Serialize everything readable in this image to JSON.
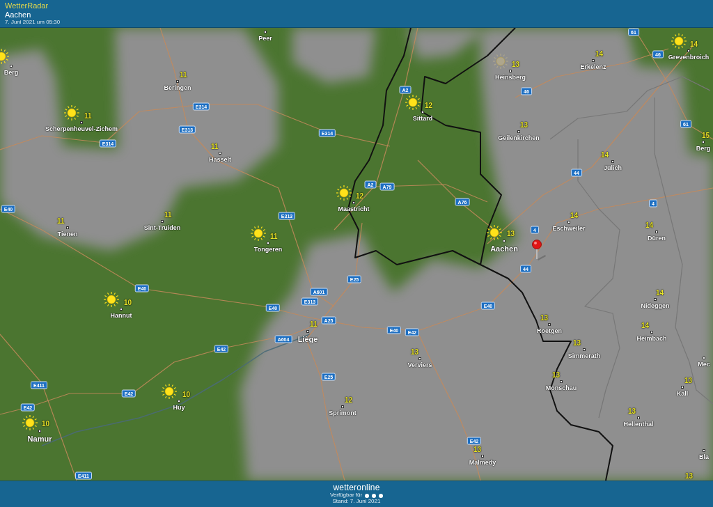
{
  "header": {
    "app_name": "WetterRadar",
    "location": "Aachen",
    "timestamp": "7. Juni 2021 um 05:30"
  },
  "map": {
    "cities": [
      {
        "kind": "plain",
        "name": "Peer",
        "major": false
      },
      {
        "kind": "sunny",
        "name": "Berg",
        "major": false
      },
      {
        "kind": "plain",
        "name": "Beringen",
        "temp": "11",
        "major": false
      },
      {
        "kind": "sunny",
        "name": "Scherpenheuvel-Zichem",
        "temp": "11",
        "major": false
      },
      {
        "kind": "plain",
        "name": "Hasselt",
        "temp": "11",
        "major": false
      },
      {
        "kind": "plain",
        "name": "Tienen",
        "temp": "11",
        "major": false
      },
      {
        "kind": "plain",
        "name": "Sint-Truiden",
        "temp": "11",
        "major": false
      },
      {
        "kind": "sunny",
        "name": "Tongeren",
        "temp": "11",
        "major": false
      },
      {
        "kind": "sunny",
        "name": "Maastricht",
        "temp": "12",
        "major": false
      },
      {
        "kind": "sunny",
        "name": "Sittard",
        "temp": "12",
        "major": false
      },
      {
        "kind": "hazy",
        "name": "Heinsberg",
        "temp": "13",
        "major": false
      },
      {
        "kind": "plain",
        "name": "Erkelenz",
        "temp": "14",
        "major": false
      },
      {
        "kind": "sunny",
        "name": "Grevenbroich",
        "temp": "14",
        "major": false
      },
      {
        "kind": "plain",
        "name": "Geilenkirchen",
        "temp": "13",
        "major": false
      },
      {
        "kind": "plain",
        "name": "Berg",
        "temp": "15",
        "major": false
      },
      {
        "kind": "plain",
        "name": "Jülich",
        "temp": "14",
        "major": false
      },
      {
        "kind": "sunny",
        "name": "Aachen",
        "temp": "13",
        "major": true
      },
      {
        "kind": "plain",
        "name": "Eschweiler",
        "temp": "14",
        "major": false
      },
      {
        "kind": "plain",
        "name": "Düren",
        "temp": "14",
        "major": false
      },
      {
        "kind": "sunny",
        "name": "Hannut",
        "temp": "10",
        "major": false
      },
      {
        "kind": "plain",
        "name": "Liège",
        "temp": "11",
        "major": true
      },
      {
        "kind": "plain",
        "name": "Verviers",
        "temp": "13",
        "major": false
      },
      {
        "kind": "plain",
        "name": "Roetgen",
        "temp": "13",
        "major": false
      },
      {
        "kind": "plain",
        "name": "Nideggen",
        "temp": "14",
        "major": false
      },
      {
        "kind": "plain",
        "name": "Simmerath",
        "temp": "13",
        "major": false
      },
      {
        "kind": "plain",
        "name": "Heimbach",
        "temp": "14",
        "major": false
      },
      {
        "kind": "plain",
        "name": "Mec",
        "major": false
      },
      {
        "kind": "plain",
        "name": "Kall",
        "temp": "13",
        "major": false
      },
      {
        "kind": "plain",
        "name": "Monschau",
        "temp": "13",
        "major": false
      },
      {
        "kind": "sunny",
        "name": "Huy",
        "temp": "10",
        "major": false
      },
      {
        "kind": "sunny",
        "name": "Namur",
        "temp": "10",
        "major": true
      },
      {
        "kind": "plain",
        "name": "Sprimont",
        "temp": "12",
        "major": false
      },
      {
        "kind": "plain",
        "name": "Hellenthal",
        "temp": "13",
        "major": false
      },
      {
        "kind": "plain",
        "name": "Malmedy",
        "temp": "13",
        "major": false
      },
      {
        "kind": "plain",
        "name": "Bla",
        "major": false
      },
      {
        "kind": "plain",
        "temp": "13",
        "major": false
      }
    ],
    "road_signs": [
      "61",
      "46",
      "A2",
      "46",
      "E314",
      "E313",
      "E314",
      "E314",
      "61",
      "44",
      "A2",
      "A79",
      "A76",
      "E40",
      "E313",
      "4",
      "4",
      "44",
      "E25",
      "E40",
      "A601",
      "E313",
      "E40",
      "A25",
      "E40",
      "E40",
      "E42",
      "A604",
      "E42",
      "E25",
      "E411",
      "E42",
      "E42",
      "E42",
      "E411"
    ]
  },
  "footer": {
    "logo": "wetteronline",
    "availability": "Verfügbar für",
    "status": "Stand: 7. Juni 2021"
  }
}
